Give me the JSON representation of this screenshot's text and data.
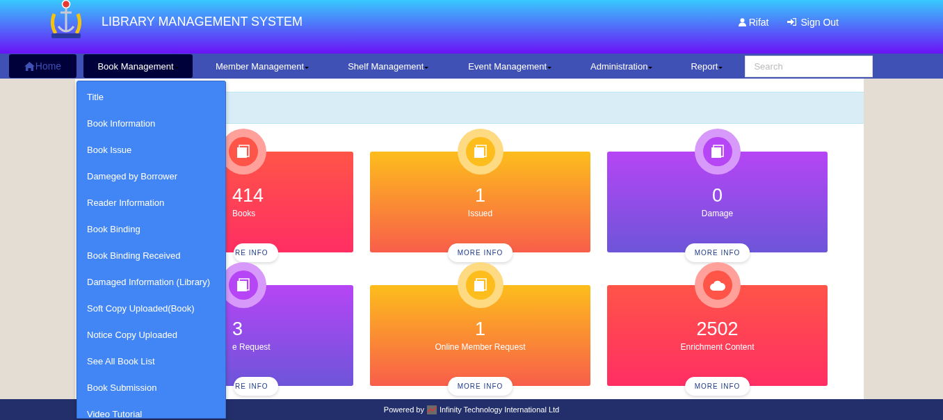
{
  "header": {
    "title": "LIBRARY MANAGEMENT SYSTEM",
    "user": "Rifat",
    "sign_out": "Sign Out"
  },
  "nav": {
    "items": [
      {
        "label": "Home",
        "kind": "home",
        "selected": true,
        "expanded": false
      },
      {
        "label": "Book Management",
        "kind": "menu",
        "selected": false,
        "expanded": true
      },
      {
        "label": "Member Management",
        "kind": "menu",
        "selected": false,
        "expanded": false
      },
      {
        "label": "Shelf Management",
        "kind": "menu",
        "selected": false,
        "expanded": false
      },
      {
        "label": "Event Management",
        "kind": "menu",
        "selected": false,
        "expanded": false
      },
      {
        "label": "Administration",
        "kind": "menu",
        "selected": false,
        "expanded": false
      },
      {
        "label": "Report",
        "kind": "menu",
        "selected": false,
        "expanded": false
      }
    ],
    "search": {
      "placeholder": "Search"
    }
  },
  "dropdown": {
    "items": [
      "Title",
      "Book Information",
      "Book Issue",
      "Dameged by Borrower",
      "Reader Information",
      "Book Binding",
      "Book Binding Received",
      "Damaged Information (Library)",
      "Soft Copy Uploaded(Book)",
      "Notice Copy Uploaded",
      "See All Book List",
      "Book Submission",
      "Video Tutorial"
    ]
  },
  "stats": [
    {
      "value": "414",
      "label": "Books",
      "button": "RE INFO",
      "kind": "book",
      "color": "#ff5448"
    },
    {
      "value": "1",
      "label": "Issued",
      "button": "MORE INFO",
      "kind": "book",
      "color": "#fdbd1c"
    },
    {
      "value": "0",
      "label": "Damage",
      "button": "MORE INFO",
      "kind": "book",
      "color": "#b645f5"
    },
    {
      "value": "3",
      "label": "e Request",
      "button": "RE INFO",
      "kind": "book",
      "color": "#b645f5"
    },
    {
      "value": "1",
      "label": "Online Member Request",
      "button": "MORE INFO",
      "kind": "book",
      "color": "#fdbd1c"
    },
    {
      "value": "2502",
      "label": "Enrichment Content",
      "button": "MORE INFO",
      "kind": "cloud",
      "color": "#ff5448"
    }
  ],
  "footer": {
    "prefix": "Powered by",
    "company": "Infinity Technology International Ltd"
  }
}
